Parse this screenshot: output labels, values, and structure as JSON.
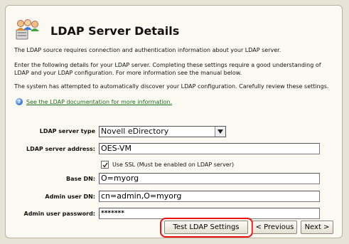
{
  "header": {
    "title": "LDAP Server Details",
    "icon": "users-server-icon"
  },
  "intro": {
    "p1": "The LDAP source requires connection and authentication information about your LDAP server.",
    "p2_line1": "Enter the following details for your LDAP server. Completing these settings require a good understanding of",
    "p2_line2": "LDAP and your LDAP configuration. For more information see the manual below.",
    "p3": "The system has attempted to automatically discover your LDAP configuration. Carefully review these settings."
  },
  "help": {
    "link_text": "See the LDAP documentation for more information."
  },
  "form": {
    "server_type": {
      "label": "LDAP server type",
      "value": "Novell eDirectory"
    },
    "server_address": {
      "label": "LDAP server address:",
      "value": "OES-VM"
    },
    "ssl": {
      "label": "Use SSL (Must be enabled on LDAP server)",
      "checked": true
    },
    "base_dn": {
      "label": "Base DN:",
      "value": "O=myorg"
    },
    "admin_dn": {
      "label": "Admin user DN:",
      "value": "cn=admin,O=myorg"
    },
    "admin_password": {
      "label": "Admin user password:",
      "value": "*******"
    }
  },
  "buttons": {
    "test": "Test LDAP Settings",
    "previous": "< Previous",
    "next": "Next >"
  },
  "colors": {
    "highlight": "#ee1111",
    "link": "#1a6b1a",
    "panel": "#fbfaf2"
  }
}
